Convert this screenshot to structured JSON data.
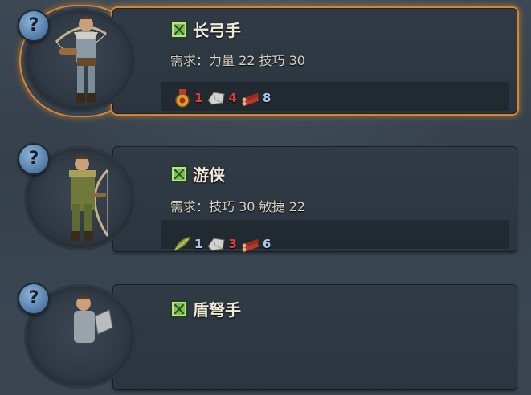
{
  "units": [
    {
      "name": "长弓手",
      "requirement": "需求：力量 22 技巧 30",
      "selected": true,
      "costs": [
        {
          "icon": "medal-icon",
          "amount": "1",
          "color": "red"
        },
        {
          "icon": "stone-icon",
          "amount": "4",
          "color": "red"
        },
        {
          "icon": "wood-icon",
          "amount": "8",
          "color": "blue"
        }
      ]
    },
    {
      "name": "游侠",
      "requirement": "需求：技巧 30 敏捷 22",
      "selected": false,
      "costs": [
        {
          "icon": "feather-icon",
          "amount": "1",
          "color": "blue"
        },
        {
          "icon": "stone-icon",
          "amount": "3",
          "color": "red"
        },
        {
          "icon": "wood-icon",
          "amount": "6",
          "color": "blue"
        }
      ]
    },
    {
      "name": "盾弩手",
      "requirement": "",
      "selected": false,
      "costs": []
    }
  ],
  "help_label": "?",
  "colors": {
    "accent": "#d8862a",
    "red": "#e23a3a",
    "blue": "#a9c7e6",
    "check": "#7dc24b"
  }
}
